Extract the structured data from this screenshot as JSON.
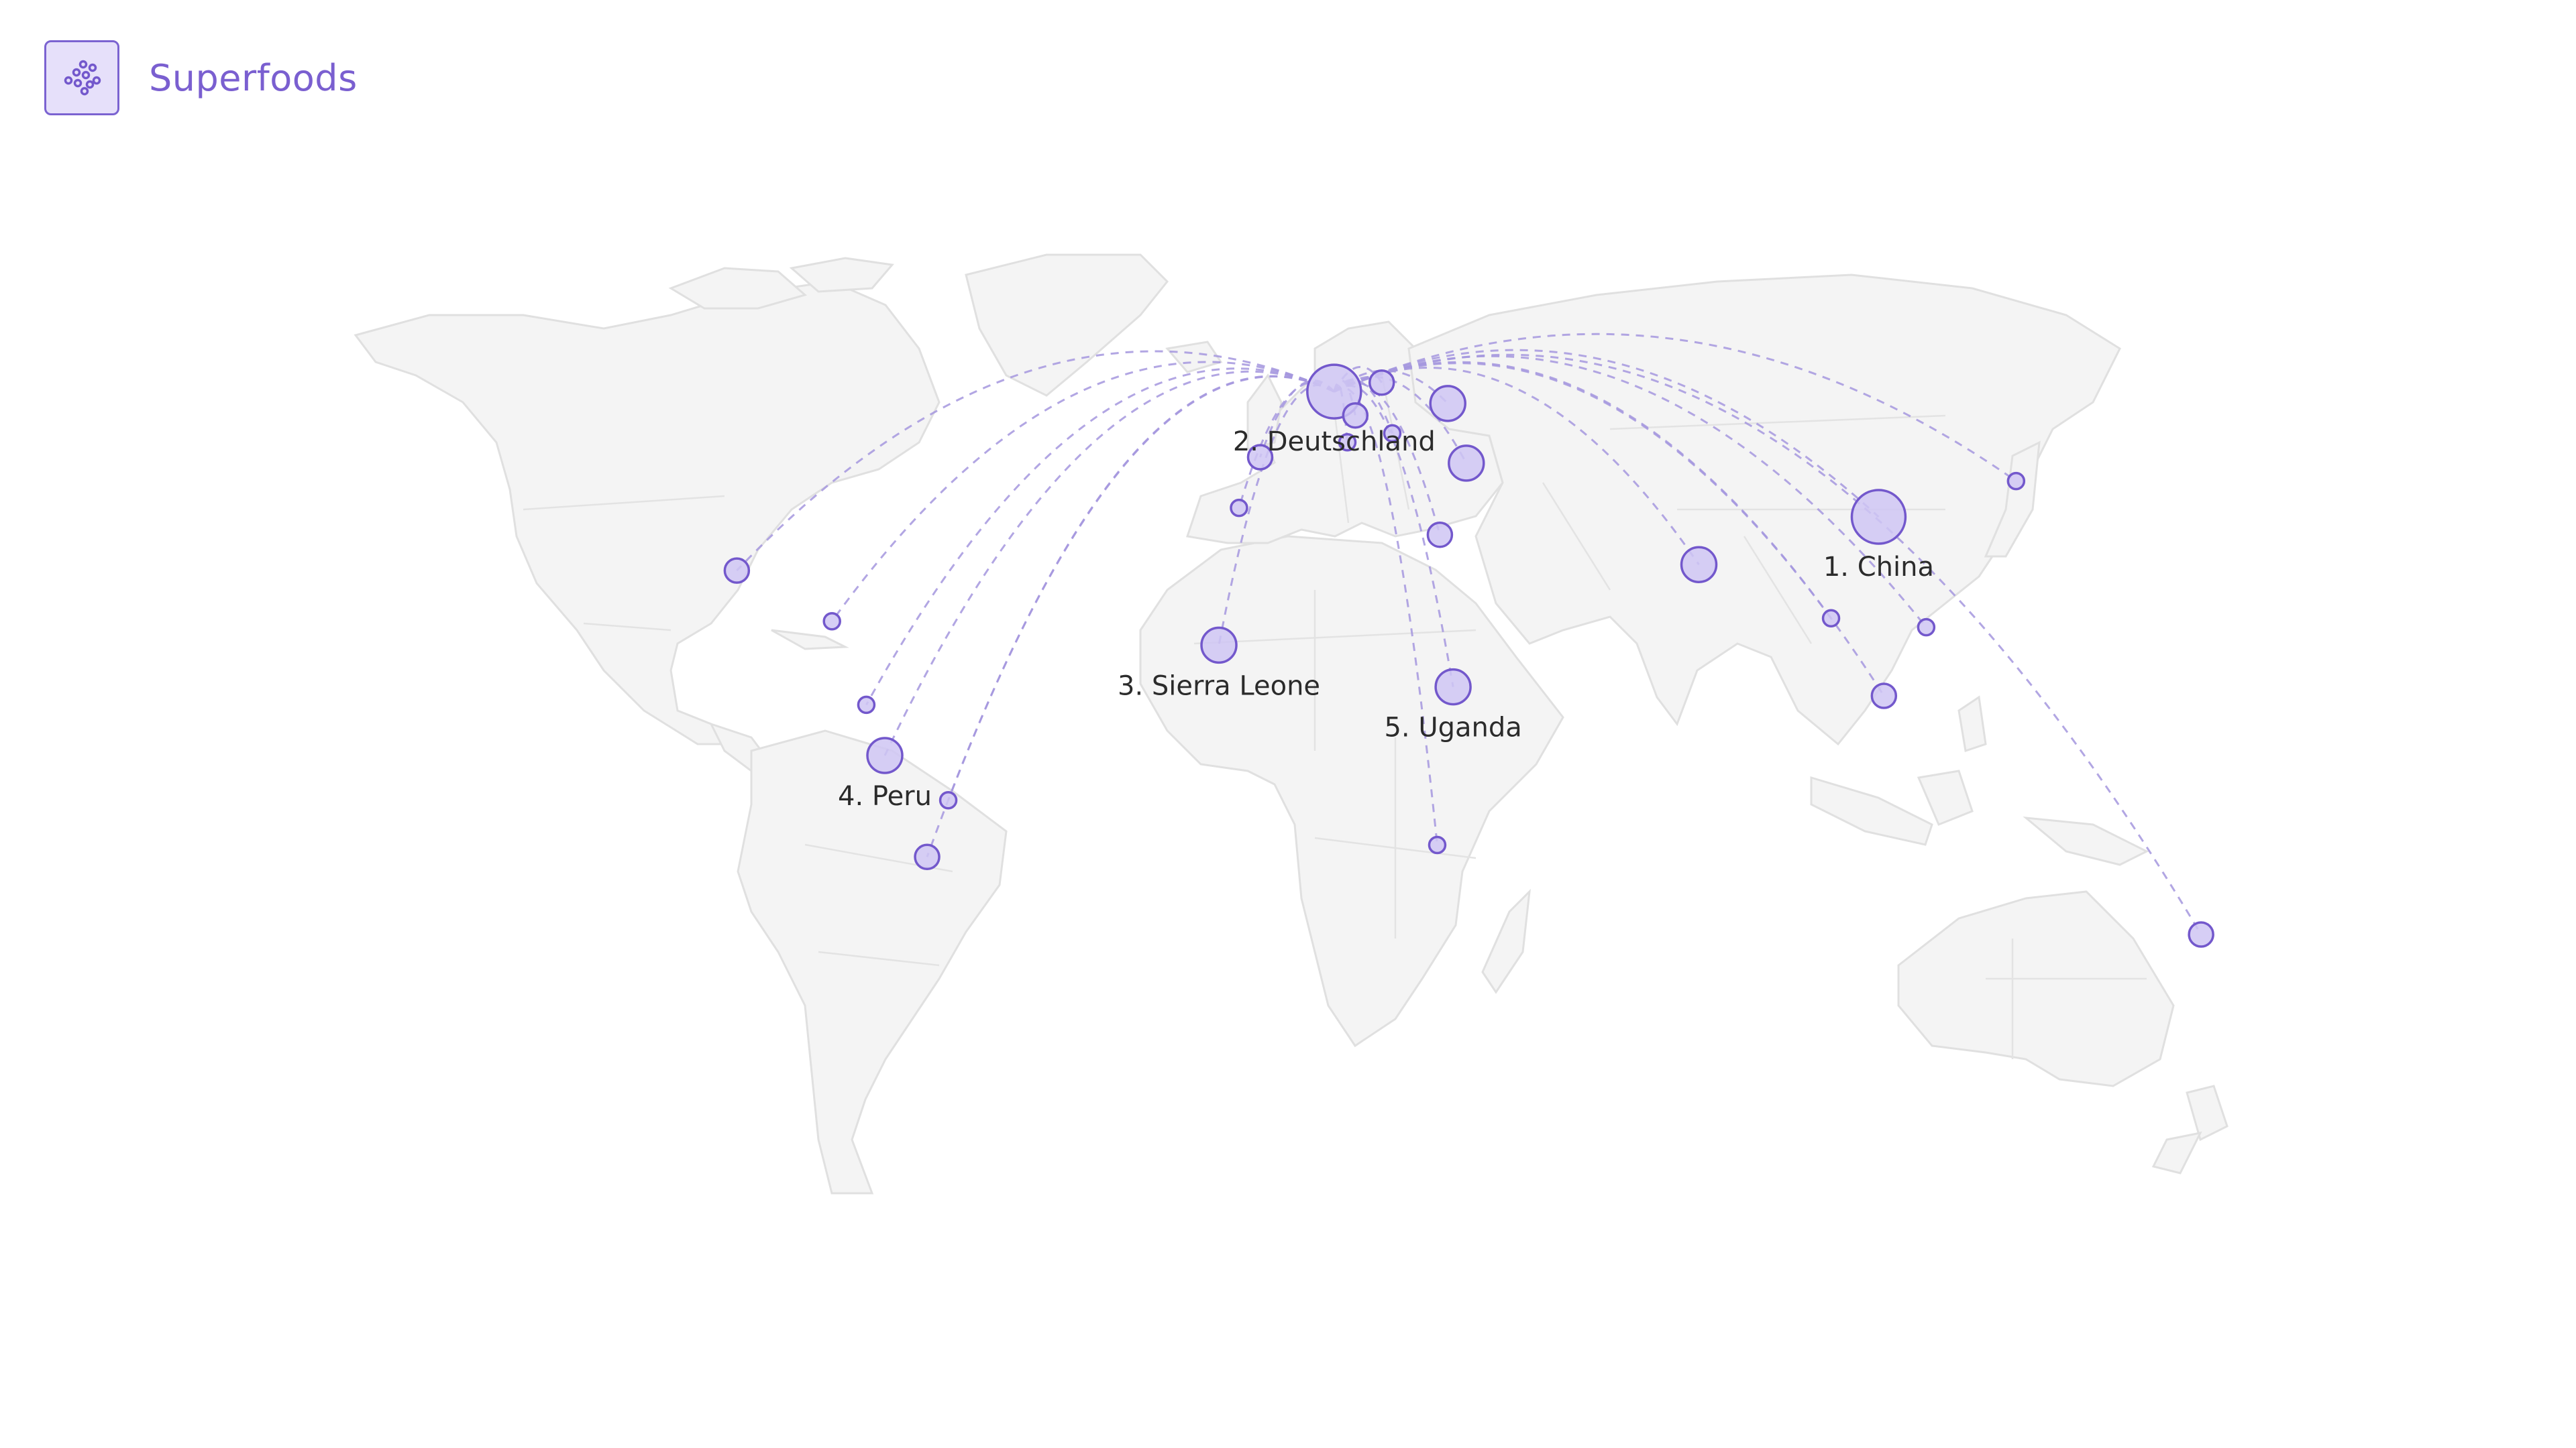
{
  "app": {
    "title": "Superfoods",
    "logo_icon": "seeds-cluster-icon"
  },
  "colors": {
    "accent": "#7a5fd0",
    "node_fill": "#cfc5f3",
    "node_stroke": "#7358cc",
    "route": "#a596de",
    "land": "#f4f4f4"
  },
  "map": {
    "hub": "Deutschland",
    "locations": [
      {
        "name": "China",
        "label": "1. China",
        "lon": 113,
        "lat": 30,
        "size": 5
      },
      {
        "name": "Deutschland",
        "label": "2. Deutschland",
        "lon": 10,
        "lat": 51,
        "size": 5
      },
      {
        "name": "Sierra Leone",
        "label": "3. Sierra Leone",
        "lon": -11.8,
        "lat": 8.5,
        "size": 3
      },
      {
        "name": "Peru",
        "label": "4. Peru",
        "lon": -75,
        "lat": -10,
        "size": 3
      },
      {
        "name": "Uganda",
        "label": "5. Uganda",
        "lon": 32.5,
        "lat": 1.5,
        "size": 3
      },
      {
        "name": "",
        "label": "",
        "lon": -103,
        "lat": 21,
        "size": 2
      },
      {
        "name": "",
        "label": "",
        "lon": -85,
        "lat": 12.5,
        "size": 1
      },
      {
        "name": "",
        "label": "",
        "lon": -78.5,
        "lat": -1.5,
        "size": 1
      },
      {
        "name": "",
        "label": "",
        "lon": -63,
        "lat": -17.5,
        "size": 1
      },
      {
        "name": "",
        "label": "",
        "lon": -67,
        "lat": -27,
        "size": 2
      },
      {
        "name": "",
        "label": "",
        "lon": -4,
        "lat": 40,
        "size": 2
      },
      {
        "name": "",
        "label": "",
        "lon": -8,
        "lat": 31.5,
        "size": 1
      },
      {
        "name": "",
        "label": "",
        "lon": 19,
        "lat": 52.5,
        "size": 2
      },
      {
        "name": "",
        "label": "",
        "lon": 14,
        "lat": 47,
        "size": 2
      },
      {
        "name": "",
        "label": "",
        "lon": 12.5,
        "lat": 42.5,
        "size": 1
      },
      {
        "name": "",
        "label": "",
        "lon": 21,
        "lat": 44,
        "size": 1
      },
      {
        "name": "",
        "label": "",
        "lon": 31.5,
        "lat": 49,
        "size": 3
      },
      {
        "name": "",
        "label": "",
        "lon": 35,
        "lat": 39,
        "size": 3
      },
      {
        "name": "",
        "label": "",
        "lon": 30,
        "lat": 27,
        "size": 2
      },
      {
        "name": "",
        "label": "",
        "lon": 29.5,
        "lat": -25,
        "size": 1
      },
      {
        "name": "",
        "label": "",
        "lon": 79,
        "lat": 22,
        "size": 3
      },
      {
        "name": "",
        "label": "",
        "lon": 104,
        "lat": 13,
        "size": 1
      },
      {
        "name": "",
        "label": "",
        "lon": 122,
        "lat": 11.5,
        "size": 1
      },
      {
        "name": "",
        "label": "",
        "lon": 114,
        "lat": 0,
        "size": 2
      },
      {
        "name": "",
        "label": "",
        "lon": 139,
        "lat": 36,
        "size": 1
      },
      {
        "name": "",
        "label": "",
        "lon": 174,
        "lat": -40,
        "size": 2
      }
    ]
  }
}
